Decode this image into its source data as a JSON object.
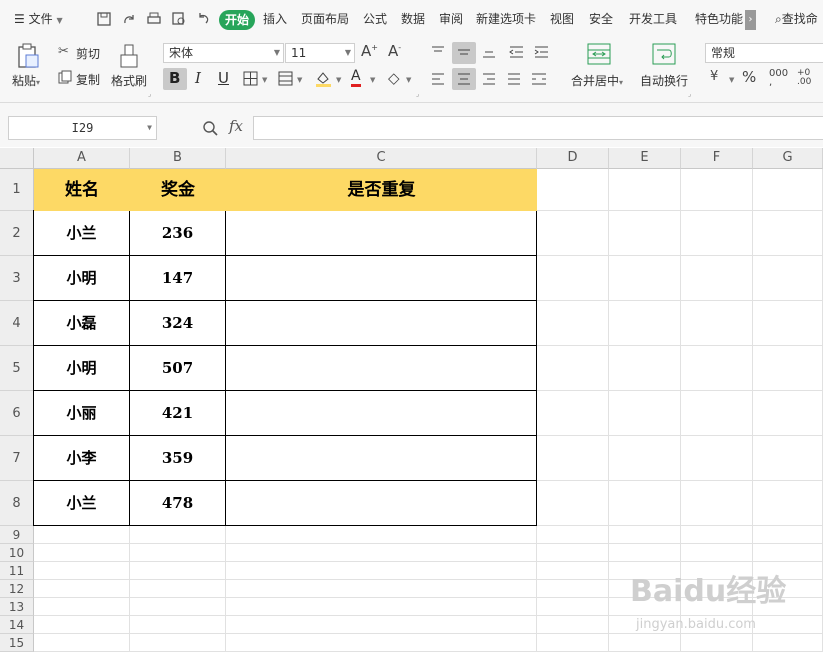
{
  "menu": {
    "hamburger_label": "文件",
    "tabs": [
      "开始",
      "插入",
      "页面布局",
      "公式",
      "数据",
      "审阅",
      "新建选项卡",
      "视图",
      "安全",
      "开发工具",
      "特色功能"
    ],
    "active_tab": "开始",
    "search_label": "查找命"
  },
  "ribbon": {
    "paste": "粘贴",
    "cut": "剪切",
    "copy": "复制",
    "format_painter": "格式刷",
    "font_name": "宋体",
    "font_size": "11",
    "merge_center": "合并居中",
    "wrap_text": "自动换行",
    "number_format": "常规"
  },
  "formula_bar": {
    "cell_ref": "I29",
    "fx": "fx",
    "formula": ""
  },
  "sheet": {
    "columns": [
      "A",
      "B",
      "C",
      "D",
      "E",
      "F",
      "G"
    ],
    "rows": [
      "1",
      "2",
      "3",
      "4",
      "5",
      "6",
      "7",
      "8",
      "9",
      "10",
      "11",
      "12",
      "13",
      "14",
      "15"
    ],
    "headers": [
      "姓名",
      "奖金",
      "是否重复"
    ],
    "data": [
      [
        "小兰",
        "236",
        ""
      ],
      [
        "小明",
        "147",
        ""
      ],
      [
        "小磊",
        "324",
        ""
      ],
      [
        "小明",
        "507",
        ""
      ],
      [
        "小丽",
        "421",
        ""
      ],
      [
        "小李",
        "359",
        ""
      ],
      [
        "小兰",
        "478",
        ""
      ]
    ],
    "header_color": "#fdd965",
    "accent_color": "#27a55a"
  },
  "watermark": {
    "main": "Baidu经验",
    "sub": "jingyan.baidu.com"
  }
}
